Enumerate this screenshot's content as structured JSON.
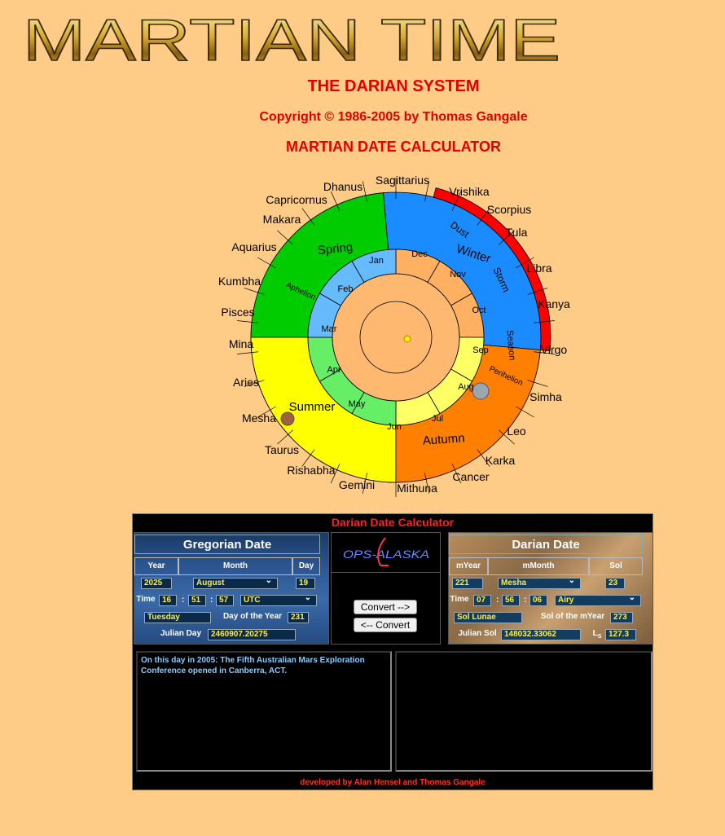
{
  "header": {
    "logo_text": "MARTIAN TIME",
    "system_title": "THE DARIAN SYSTEM",
    "copyright": "Copyright © 1986-2005 by Thomas Gangale",
    "calculator_title": "MARTIAN DATE CALCULATOR"
  },
  "wheel": {
    "outer_labels": [
      "Sagittarius",
      "Vrishika",
      "Scorpius",
      "Tula",
      "Libra",
      "Kanya",
      "Virgo",
      "Simha",
      "Leo",
      "Karka",
      "Cancer",
      "Mithuna",
      "Gemini",
      "Rishabha",
      "Taurus",
      "Mesha",
      "Aries",
      "Mina",
      "Pisces",
      "Kumbha",
      "Aquarius",
      "Makara",
      "Capricornus",
      "Dhanus"
    ],
    "season_labels": [
      "Spring",
      "Winter",
      "Summer",
      "Autumn"
    ],
    "month_labels": [
      "Jan",
      "Feb",
      "Mar",
      "Apr",
      "May",
      "Jun",
      "Jul",
      "Aug",
      "Sep",
      "Oct",
      "Nov",
      "Dec"
    ],
    "special_labels": [
      "Dust",
      "Storm",
      "Season",
      "Aphelion",
      "Perihelion",
      "Mesha"
    ],
    "colors": {
      "spring": "#00cc00",
      "winter": "#1a8cff",
      "summer": "#ffff00",
      "autumn": "#ff8000",
      "dust": "#ff0000",
      "background": "#ffcc88"
    }
  },
  "calculator": {
    "title": "Darian Date Calculator",
    "gregorian": {
      "title": "Gregorian Date",
      "year_label": "Year",
      "month_label": "Month",
      "day_label": "Day",
      "year": "2025",
      "month": "August",
      "day": "19",
      "time_label": "Time",
      "hour": "16",
      "minute": "51",
      "second": "57",
      "timezone": "UTC",
      "weekday": "Tuesday",
      "day_of_year_label": "Day of the Year",
      "day_of_year": "231",
      "julian_day_label": "Julian Day",
      "julian_day": "2460907.20275"
    },
    "middle": {
      "logo_text": "OPS-ALASKA",
      "convert_forward": "Convert -->",
      "convert_back": "<-- Convert"
    },
    "darian": {
      "title": "Darian Date",
      "myear_label": "mYear",
      "mmonth_label": "mMonth",
      "sol_label": "Sol",
      "myear": "221",
      "mmonth": "Mesha",
      "sol": "23",
      "time_label": "Time",
      "hour": "07",
      "minute": "56",
      "second": "06",
      "timezone": "Airy",
      "weekday": "Sol Lunae",
      "sol_of_myear_label": "Sol of the mYear",
      "sol_of_myear": "273",
      "julian_sol_label": "Julian Sol",
      "julian_sol": "148032.33062",
      "ls_label": "L",
      "ls_sub": "S",
      "ls": "127.3"
    },
    "event_text": "On this day in 2005: The Fifth Australian Mars Exploration Conference opened in Canberra, ACT.",
    "credit": "developed by Alan Hensel and Thomas Gangale"
  }
}
